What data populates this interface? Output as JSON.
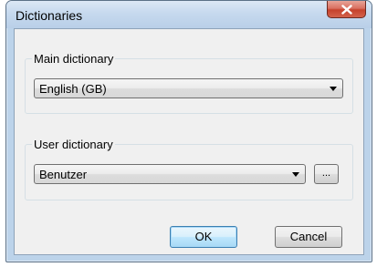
{
  "window": {
    "title": "Dictionaries",
    "close_symbol": "x"
  },
  "main_dictionary": {
    "label": "Main dictionary",
    "selected": "English (GB)"
  },
  "user_dictionary": {
    "label": "User dictionary",
    "selected": "Benutzer",
    "browse_label": "..."
  },
  "buttons": {
    "ok": "OK",
    "cancel": "Cancel"
  },
  "colors": {
    "frame": "#bcd3ea",
    "client": "#f0f0f0",
    "close_button": "#c5412c",
    "default_button_border": "#3c7fb1"
  },
  "icons": {
    "close": "close-icon",
    "dropdown": "chevron-down-icon"
  }
}
